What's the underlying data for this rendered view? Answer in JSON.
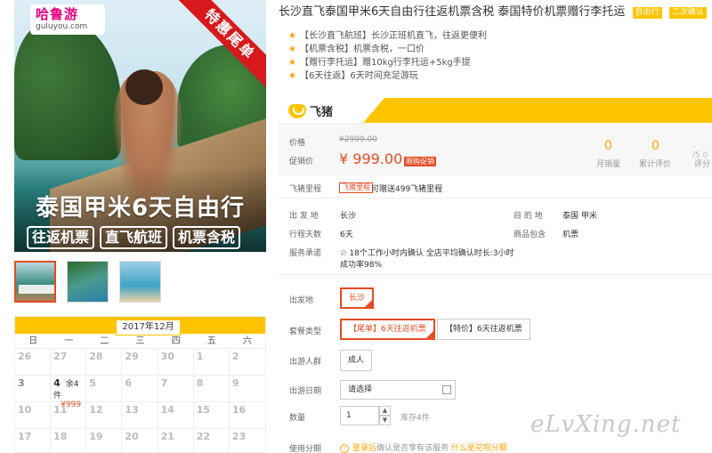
{
  "hero": {
    "logo_cn": "哈鲁游",
    "logo_en": "guluyou.com",
    "ribbon": "特惠尾单",
    "title": "泰国甲米6天自由行",
    "tags": [
      "往返机票",
      "直飞航班",
      "机票含税"
    ]
  },
  "calendar": {
    "month": "2017年12月",
    "weekdays": [
      "日",
      "一",
      "二",
      "三",
      "四",
      "五",
      "六"
    ],
    "rows": [
      [
        {
          "d": "26"
        },
        {
          "d": "27"
        },
        {
          "d": "28"
        },
        {
          "d": "29"
        },
        {
          "d": "30"
        },
        {
          "d": "1"
        },
        {
          "d": "2"
        }
      ],
      [
        {
          "d": "3"
        },
        {
          "d": "4",
          "remaining": "余4件",
          "price": "¥999"
        },
        {
          "d": "5"
        },
        {
          "d": "6"
        },
        {
          "d": "7"
        },
        {
          "d": "8"
        },
        {
          "d": "9"
        }
      ],
      [
        {
          "d": "10"
        },
        {
          "d": "11"
        },
        {
          "d": "12"
        },
        {
          "d": "13"
        },
        {
          "d": "14"
        },
        {
          "d": "15"
        },
        {
          "d": "16"
        }
      ],
      [
        {
          "d": "17"
        },
        {
          "d": "18"
        },
        {
          "d": "19"
        },
        {
          "d": "20"
        },
        {
          "d": "21"
        },
        {
          "d": "22"
        },
        {
          "d": "23"
        }
      ]
    ]
  },
  "product": {
    "title": "长沙直飞泰国甲米6天自由行往返机票含税 泰国特价机票赠行李托运",
    "badges": [
      "自由行",
      "二次确认"
    ],
    "highlights": [
      "【长沙直飞航班】长沙正班机直飞，往返更便利",
      "【机票含税】机票含税，一口价",
      "【赠行李托运】赠10kg行李托运+5kg手提",
      "【6天往返】6天时间充足游玩"
    ]
  },
  "fliggy": {
    "logo_text": "飞猪"
  },
  "price": {
    "label_price": "价格",
    "original": "¥2999.00",
    "label_promo": "促销价",
    "promo": "¥ 999.00",
    "promo_tag": "限购促销"
  },
  "stats": {
    "monthly_sales": "0",
    "monthly_label": "月销量",
    "reviews": "0",
    "reviews_label": "累计评价",
    "rating": "- /5.0",
    "rating_label": "评分"
  },
  "mileage": {
    "label": "飞猪里程",
    "tag": "飞猪里程",
    "text": "可赠送499飞猪里程"
  },
  "details": {
    "departure_label": "出 发 地",
    "departure": "长沙",
    "destination_label": "目 的 地",
    "destination": "泰国  甲米",
    "days_label": "行程天数",
    "days": "6天",
    "includes_label": "商品包含",
    "includes": "机票",
    "service_label": "服务承诺",
    "service_line1": "18个工作小时内确认 全店平均确认时长:3小时",
    "service_line2": "成功率98%"
  },
  "options": {
    "departure_label": "出发地",
    "departure_value": "长沙",
    "package_label": "套餐类型",
    "package_a": "【尾单】6天往返机票",
    "package_b": "【特价】6天往返机票",
    "group_label": "出游人群",
    "group_value": "成人",
    "date_label": "出游日期",
    "date_placeholder": "请选择",
    "qty_label": "数量",
    "qty_value": "1",
    "stock": "库存4件",
    "installment_label": "使用分期",
    "installment_link": "登录后",
    "installment_text": "确认是否享有该服务",
    "installment_help": "什么是花呗分期"
  },
  "watermark": "eLvXing.net"
}
